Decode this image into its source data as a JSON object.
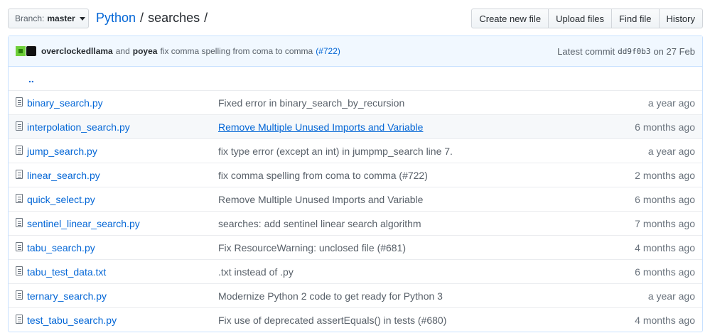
{
  "branch": {
    "label": "Branch:",
    "name": "master"
  },
  "breadcrumb": {
    "repo": "Python",
    "sep1": "/",
    "folder": "searches",
    "sep2": "/"
  },
  "actions": [
    "Create new file",
    "Upload files",
    "Find file",
    "History"
  ],
  "latest_commit": {
    "author1": "overclockedllama",
    "and": "and",
    "author2": "poyea",
    "message": "fix comma spelling from coma to comma",
    "pr": "(#722)",
    "prefix": "Latest commit",
    "sha": "dd9f0b3",
    "date": "on 27 Feb"
  },
  "up_link": "..",
  "files": [
    {
      "name": "binary_search.py",
      "message": "Fixed error in binary_search_by_recursion",
      "age": "a year ago"
    },
    {
      "name": "interpolation_search.py",
      "message": "Remove Multiple Unused Imports and Variable",
      "age": "6 months ago"
    },
    {
      "name": "jump_search.py",
      "message": "fix type error (except an int) in jumpmp_search line 7.",
      "age": "a year ago"
    },
    {
      "name": "linear_search.py",
      "message": "fix comma spelling from coma to comma (#722)",
      "age": "2 months ago"
    },
    {
      "name": "quick_select.py",
      "message": "Remove Multiple Unused Imports and Variable",
      "age": "6 months ago"
    },
    {
      "name": "sentinel_linear_search.py",
      "message": "searches: add sentinel linear search algorithm",
      "age": "7 months ago"
    },
    {
      "name": "tabu_search.py",
      "message": "Fix ResourceWarning: unclosed file (#681)",
      "age": "4 months ago"
    },
    {
      "name": "tabu_test_data.txt",
      "message": ".txt instead of .py",
      "age": "6 months ago"
    },
    {
      "name": "ternary_search.py",
      "message": "Modernize Python 2 code to get ready for Python 3",
      "age": "a year ago"
    },
    {
      "name": "test_tabu_search.py",
      "message": "Fix use of deprecated assertEquals() in tests (#680)",
      "age": "4 months ago"
    }
  ]
}
